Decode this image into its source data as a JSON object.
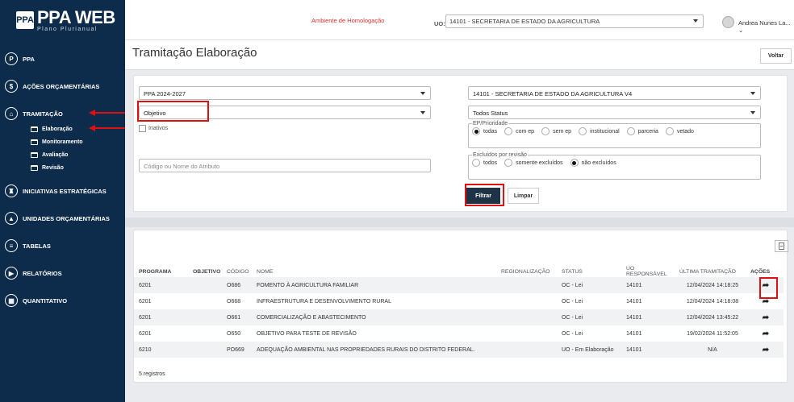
{
  "brand": {
    "logo_icon": "PPA",
    "title": "PPA WEB",
    "subtitle": "Plano Plurianual"
  },
  "sidebar": {
    "items": [
      {
        "label": "PPA",
        "icon": "P"
      },
      {
        "label": "AÇÕES ORÇAMENTÁRIAS",
        "icon": "$"
      },
      {
        "label": "TRAMITAÇÃO",
        "icon": "⌂"
      },
      {
        "label": "INICIATIVAS ESTRATÉGICAS",
        "icon": "♜"
      },
      {
        "label": "UNIDADES ORÇAMENTÁRIAS",
        "icon": "▲"
      },
      {
        "label": "TABELAS",
        "icon": "≡"
      },
      {
        "label": "RELATÓRIOS",
        "icon": "▶"
      },
      {
        "label": "QUANTITATIVO",
        "icon": "▦"
      }
    ],
    "tramitacao_sub": [
      "Elaboração",
      "Monitoramento",
      "Avaliação",
      "Revisão"
    ]
  },
  "topbar": {
    "environment": "Ambiente de Homologação",
    "uo_label": "UO:",
    "uo_value": "14101 - SECRETARIA DE ESTADO DA AGRICULTURA",
    "user": "Andrea Nunes La... ⌄"
  },
  "page": {
    "title": "Tramitação Elaboração",
    "back_button": "Voltar"
  },
  "filters": {
    "ppa": "PPA 2024-2027",
    "tipo": "Objetivo",
    "inativos": "Inativos",
    "atributo_placeholder": "Código ou Nome do Atributo",
    "unidade": "14101 - SECRETARIA DE ESTADO DA AGRICULTURA V4",
    "status": "Todos Status",
    "ep_legend": "EP/Prioridade",
    "ep_options": [
      "todas",
      "com ep",
      "sem ep",
      "institucional",
      "parceria",
      "vetado"
    ],
    "ep_selected": 0,
    "excl_legend": "Excluídos por revisão",
    "excl_options": [
      "todos",
      "somente excluídos",
      "não excluídos"
    ],
    "excl_selected": 2,
    "filter_button": "Filtrar",
    "clear_button": "Limpar"
  },
  "table": {
    "headers": [
      "PROGRAMA",
      "OBJETIVO",
      "CÓDIGO",
      "NOME",
      "REGIONALIZAÇÃO",
      "STATUS",
      "UO RESPONSÁVEL",
      "ÚLTIMA TRAMITAÇÃO",
      "AÇÕES"
    ],
    "rows": [
      [
        "6201",
        "",
        "O686",
        "FOMENTO À AGRICULTURA FAMILIAR",
        "",
        "OC - Lei",
        "14101",
        "12/04/2024 14:18:25"
      ],
      [
        "6201",
        "",
        "O668",
        "INFRAESTRUTURA E DESENVOLVIMENTO RURAL",
        "",
        "OC - Lei",
        "14101",
        "12/04/2024 14:18:08"
      ],
      [
        "6201",
        "",
        "O661",
        "COMERCIALIZAÇÃO E ABASTECIMENTO",
        "",
        "OC - Lei",
        "14101",
        "12/04/2024 13:45:22"
      ],
      [
        "6201",
        "",
        "O650",
        "OBJETIVO PARA TESTE DE REVISÃO",
        "",
        "OC - Lei",
        "14101",
        "19/02/2024 11:52:05"
      ],
      [
        "6210",
        "",
        "PO669",
        "ADEQUAÇÃO AMBIENTAL NAS PROPRIEDADES RURAIS DO DISTRITO FEDERAL.",
        "",
        "UO - Em Elaboração",
        "14101",
        "N/A"
      ]
    ],
    "action_icon": "➦",
    "count_text": "5 registros"
  }
}
